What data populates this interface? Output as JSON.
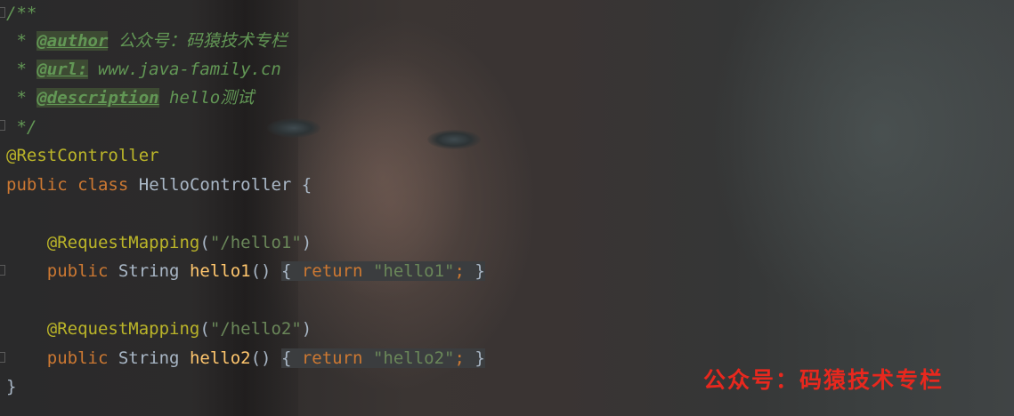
{
  "editor": {
    "language": "java",
    "theme_colors": {
      "background": "#2b2b2b",
      "doc_comment": "#629755",
      "annotation": "#bbb529",
      "keyword": "#cc7832",
      "string": "#6a8759",
      "method": "#ffc66d",
      "text": "#a9b7c6"
    },
    "doc": {
      "open": "/**",
      "author_tag": "@author",
      "author_value": " 公众号：码猿技术专栏",
      "url_tag": "@url:",
      "url_value": " www.java-family.cn",
      "desc_tag": "@description",
      "desc_value": " hello测试",
      "star": " * ",
      "close": " */"
    },
    "class_annotation": "@RestController",
    "class_decl": {
      "kw1": "public",
      "kw2": "class",
      "name": "HelloController",
      "open": "{"
    },
    "methods": [
      {
        "annotation": "@RequestMapping",
        "arg": "\"/hello1\"",
        "kw": "public",
        "type": "String",
        "name": "hello1",
        "parens": "()",
        "body_open": "{",
        "ret": "return",
        "ret_value": "\"hello1\"",
        "semi": ";",
        "body_close": "}"
      },
      {
        "annotation": "@RequestMapping",
        "arg": "\"/hello2\"",
        "kw": "public",
        "type": "String",
        "name": "hello2",
        "parens": "()",
        "body_open": "{",
        "ret": "return",
        "ret_value": "\"hello2\"",
        "semi": ";",
        "body_close": "}"
      }
    ],
    "class_close": "}"
  },
  "watermark": "公众号：码猿技术专栏"
}
